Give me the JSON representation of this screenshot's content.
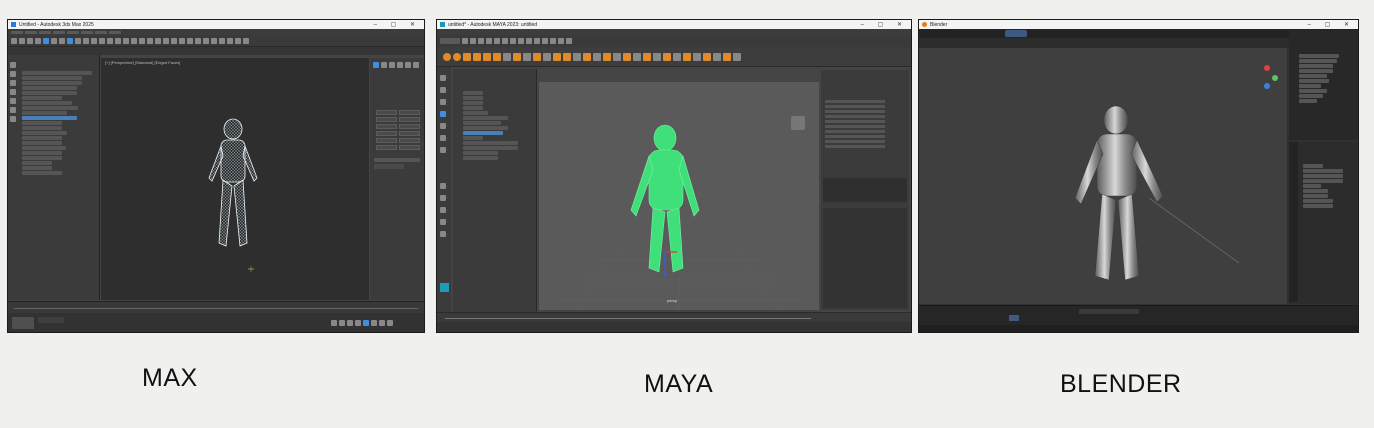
{
  "captions": [
    "MAX",
    "MAYA",
    "BLENDER"
  ],
  "max": {
    "title": "Untitled - Autodesk 3ds Max 2025",
    "viewport_label": "[+] [Perspective] [Standard] [Edged Faces]",
    "colors": {
      "frame": "#4a4a4a",
      "viewport": "#2e2e2e",
      "model": "#e6eef2"
    }
  },
  "maya": {
    "title": "untitled* - Autodesk MAYA 2023: untitled",
    "viewport_label": "persp",
    "colors": {
      "frame": "#444444",
      "viewport": "#5a5a5a",
      "model": "#3fe07a"
    }
  },
  "blender": {
    "title": "Blender",
    "colors": {
      "frame": "#303030",
      "viewport": "#3f3f3f",
      "model": "#9a9a9a"
    }
  }
}
